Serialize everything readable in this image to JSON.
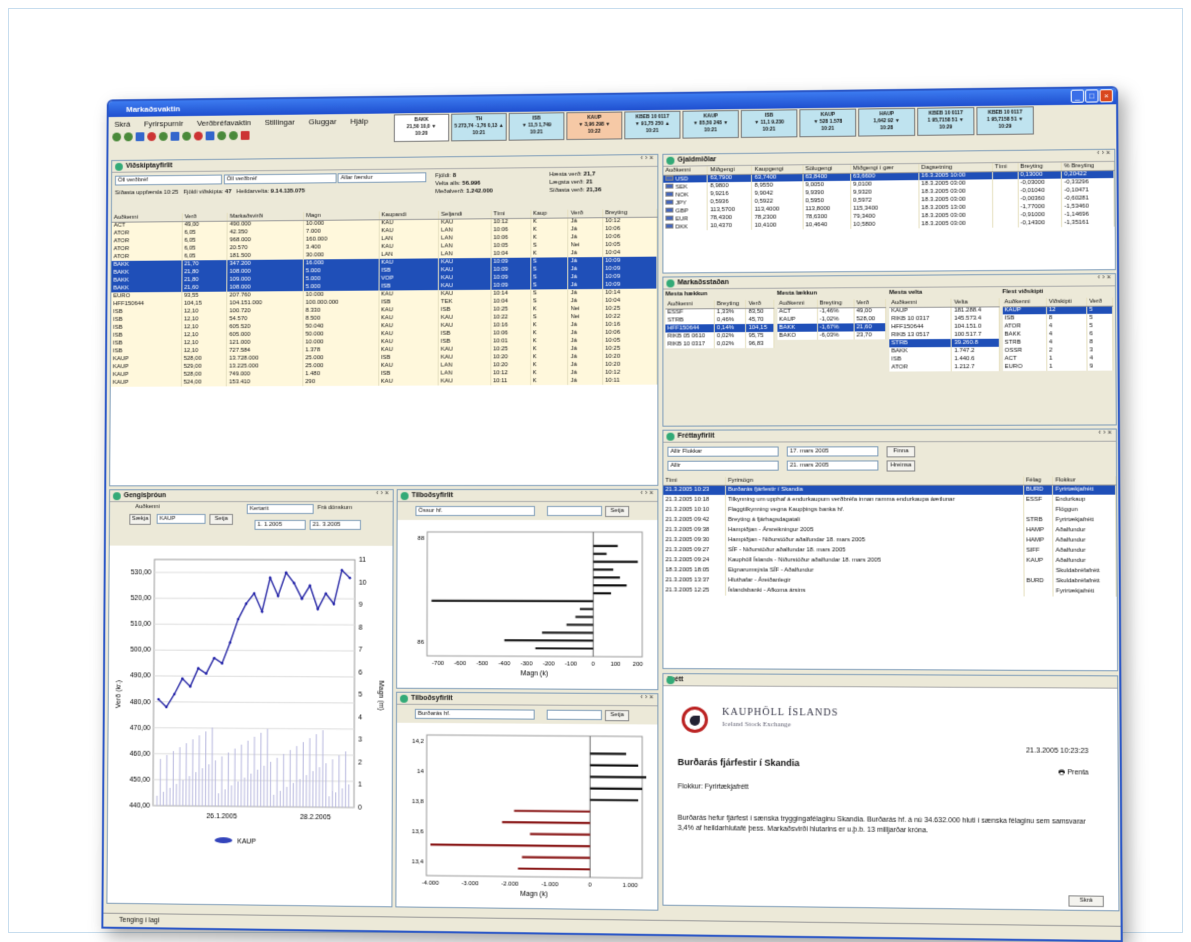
{
  "window": {
    "title": "Markaðsvaktin"
  },
  "menu": [
    "Skrá",
    "Fyrirspurnir",
    "Verðbréfavaktin",
    "Stillingar",
    "Gluggar",
    "Hjálp"
  ],
  "tickers": [
    {
      "l1": "BAKK",
      "l2": "21,50 10,0 ▼",
      "l3": "10:20",
      "color": "#fff",
      "up": false
    },
    {
      "l1": "TH",
      "l2": "5 273,74 -1,76 0,13 ▲",
      "l3": "10:21",
      "color": "#bfe3ef",
      "up": true
    },
    {
      "l1": "ISB",
      "l2": "▼ 11,5 1,749",
      "l3": "10:21",
      "color": "#bfe3ef",
      "up": true
    },
    {
      "l1": "KAUP",
      "l2": "▼ 3,96 298 ▼",
      "l3": "10:22",
      "color": "#f6c9a6",
      "up": false
    },
    {
      "l1": "KBEB 10 0117",
      "l2": "▼ 91,75 250 ▲",
      "l3": "10:21",
      "color": "#bfe3ef",
      "up": true
    },
    {
      "l1": "KAUP",
      "l2": "▼ 85,50 248 ▼",
      "l3": "10:21",
      "color": "#bfe3ef",
      "up": true
    },
    {
      "l1": "ISB",
      "l2": "▼ 11,1 9.230",
      "l3": "10:21",
      "color": "#bfe3ef",
      "up": true
    },
    {
      "l1": "KAUP",
      "l2": "▼ 528 1.578",
      "l3": "10:21",
      "color": "#bfe3ef",
      "up": false
    },
    {
      "l1": "HAUP",
      "l2": "1,642 92 ▼",
      "l3": "10:28",
      "color": "#bfe3ef",
      "up": false
    },
    {
      "l1": "KBEB 10 0117",
      "l2": "1 95,7158 51 ▼",
      "l3": "10:29",
      "color": "#bfe3ef",
      "up": true
    },
    {
      "l1": "KBEB 10 0117",
      "l2": "1 95,7158 51 ▼",
      "l3": "10:29",
      "color": "#bfe3ef",
      "up": true
    }
  ],
  "securities": {
    "title": "Viðskiptayfirlit",
    "filter1": "Öll verðbréf",
    "filter2": "Öll verðbréf",
    "filter3": "Allar færslur",
    "updated": "Síðasta uppfærsla 10:25",
    "total_label": "Fjöldi viðskipta:",
    "total": "47",
    "turnover_label": "Heildarvelta:",
    "turnover": "9.14.135.075",
    "stats": [
      [
        "Fjöldi:",
        "8"
      ],
      [
        "Velta alls:",
        "56.996"
      ],
      [
        "Meðalverð:",
        "1.242.000"
      ]
    ],
    "stats2": [
      [
        "Hæsta verð:",
        "21,7"
      ],
      [
        "Lægsta verð:",
        "21"
      ],
      [
        "Síðasta verð:",
        "21,36"
      ]
    ],
    "columns": [
      "Auðkenni",
      "Verð",
      "Markaðsvirði",
      "Magn",
      "Kaupandi",
      "Seljandi",
      "Tími",
      "Kaup",
      "Verð",
      "Breyting"
    ],
    "rows": [
      [
        "ACT",
        "49,00",
        "490.000",
        "10.000",
        "KAU",
        "KAU",
        "10:12",
        "K",
        "Já",
        "10:12"
      ],
      [
        "ATOR",
        "6,05",
        "42.350",
        "7.000",
        "KAU",
        "LAN",
        "10:06",
        "K",
        "Já",
        "10:06"
      ],
      [
        "ATOR",
        "6,05",
        "968.000",
        "160.000",
        "LAN",
        "LAN",
        "10:06",
        "K",
        "Já",
        "10:06"
      ],
      [
        "ATOR",
        "6,05",
        "20.570",
        "3.400",
        "KAU",
        "LAN",
        "10:05",
        "S",
        "Nei",
        "10:05"
      ],
      [
        "ATOR",
        "6,05",
        "181.500",
        "30.000",
        "LAN",
        "LAN",
        "10:04",
        "K",
        "Já",
        "10:04"
      ],
      [
        "BAKK",
        "21,70",
        "347.200",
        "16.000",
        "KAU",
        "KAU",
        "10:09",
        "S",
        "Já",
        "10:09"
      ],
      [
        "BAKK",
        "21,80",
        "108.000",
        "5.000",
        "ISB",
        "KAU",
        "10:09",
        "S",
        "Já",
        "10:09"
      ],
      [
        "BAKK",
        "21,80",
        "109.000",
        "5.000",
        "VOP",
        "KAU",
        "10:09",
        "S",
        "Já",
        "10:09"
      ],
      [
        "BAKK",
        "21,60",
        "108.000",
        "5.000",
        "ISB",
        "KAU",
        "10:09",
        "S",
        "Já",
        "10:09"
      ],
      [
        "EURO",
        "93,55",
        "207.760",
        "10.000",
        "KAU",
        "KAU",
        "10:14",
        "S",
        "Já",
        "10:14"
      ],
      [
        "HFF150644",
        "104,15",
        "104.151.000",
        "100.000.000",
        "ISB",
        "TEK",
        "10:04",
        "S",
        "Já",
        "10:04"
      ],
      [
        "ISB",
        "12,10",
        "100.720",
        "8.330",
        "KAU",
        "ISB",
        "10:25",
        "K",
        "Nei",
        "10:25"
      ],
      [
        "ISB",
        "12,10",
        "54.570",
        "8.500",
        "KAU",
        "KAU",
        "10:22",
        "S",
        "Nei",
        "10:22"
      ],
      [
        "ISB",
        "12,10",
        "605.520",
        "50.040",
        "KAU",
        "KAU",
        "10:16",
        "K",
        "Já",
        "10:16"
      ],
      [
        "ISB",
        "12,10",
        "605.000",
        "50.000",
        "KAU",
        "ISB",
        "10:06",
        "K",
        "Já",
        "10:06"
      ],
      [
        "ISB",
        "12,10",
        "121.000",
        "10.000",
        "KAU",
        "ISB",
        "10:01",
        "K",
        "Já",
        "10:05"
      ],
      [
        "ISB",
        "12,10",
        "727.584",
        "1.378",
        "KAU",
        "KAU",
        "10:25",
        "K",
        "Já",
        "10:25"
      ],
      [
        "KAUP",
        "528,00",
        "13.728.000",
        "25.000",
        "ISB",
        "KAU",
        "10:20",
        "K",
        "Já",
        "10:20"
      ],
      [
        "KAUP",
        "529,00",
        "13.225.000",
        "25.000",
        "KAU",
        "LAN",
        "10:20",
        "K",
        "Já",
        "10:20"
      ],
      [
        "KAUP",
        "528,00",
        "749.000",
        "1.480",
        "ISB",
        "LAN",
        "10:12",
        "K",
        "Já",
        "10:12"
      ],
      [
        "KAUP",
        "524,00",
        "153.410",
        "290",
        "KAU",
        "KAU",
        "10:11",
        "K",
        "Já",
        "10:11"
      ]
    ]
  },
  "currency": {
    "title": "Gjaldmiðlar",
    "columns": [
      "Auðkenni",
      "Miðgengi",
      "Kaupgengi",
      "Sölugengi",
      "Miðgengi í gær",
      "Dagsetning",
      "Tími",
      "Breyting",
      "% Breyting"
    ],
    "rows": [
      [
        "USD",
        "63,7900",
        "63,7400",
        "63,8400",
        "63,6600",
        "16.3.2005 10:00",
        "",
        "0,13000",
        "0,20422"
      ],
      [
        "SEK",
        "8,9800",
        "8,9550",
        "9,0050",
        "9,0100",
        "18.3.2005 03:00",
        "",
        "-0,03000",
        "-0,33296"
      ],
      [
        "NOK",
        "9,9216",
        "9,9042",
        "9,9390",
        "9,9320",
        "18.3.2005 03:00",
        "",
        "-0,01040",
        "-0,10471"
      ],
      [
        "JPY",
        "0,5936",
        "0,5922",
        "0,5950",
        "0,5972",
        "18.3.2005 03:00",
        "",
        "-0,00360",
        "-0,60281"
      ],
      [
        "GBP",
        "113,5700",
        "113,4000",
        "113,8000",
        "115,3400",
        "18.3.2005 13:00",
        "",
        "-1,77000",
        "-1,53460"
      ],
      [
        "EUR",
        "78,4300",
        "78,2300",
        "78,6300",
        "79,3400",
        "18.3.2005 03:00",
        "",
        "-0,91000",
        "-1,14696"
      ],
      [
        "DKK",
        "10,4370",
        "10,4100",
        "10,4640",
        "10,5800",
        "18.3.2005 03:00",
        "",
        "-0,14300",
        "-1,35161"
      ]
    ]
  },
  "market": {
    "title": "Markaðsstaðan",
    "sections": [
      {
        "heading": "Mesta hækkun",
        "cols": [
          "Auðkenni",
          "Breyting",
          "Verð"
        ],
        "rows": [
          [
            "ESSF",
            "1,33%",
            "83,50"
          ],
          [
            "STRB",
            "0,46%",
            "45,70"
          ],
          [
            "HFF150644",
            "0,14%",
            "104,15"
          ],
          [
            "RIKB 05 0610",
            "0,02%",
            "95,75"
          ],
          [
            "RIKB 10 0317",
            "0,02%",
            "96,83"
          ]
        ]
      },
      {
        "heading": "Mesta lækkun",
        "cols": [
          "Auðkenni",
          "Breyting",
          "Verð"
        ],
        "rows": [
          [
            "ACT",
            "-1,46%",
            "49,00"
          ],
          [
            "KAUP",
            "-1,02%",
            "528,00"
          ],
          [
            "BAKK",
            "-1,67%",
            "21,60"
          ],
          [
            "BAKO",
            "-6,03%",
            "23,70"
          ]
        ]
      },
      {
        "heading": "Mesta velta",
        "cols": [
          "Auðkenni",
          "Velta"
        ],
        "rows": [
          [
            "KAUP",
            "181.288.4"
          ],
          [
            "RIKB 10 0317",
            "145.573.4"
          ],
          [
            "HFF150644",
            "104.151.0"
          ],
          [
            "RIKB 13 0517",
            "100.517.7"
          ],
          [
            "STRB",
            "39.260.8"
          ],
          [
            "BAKK",
            "1.747.2"
          ],
          [
            "ISB",
            "1.440.6"
          ],
          [
            "ATOR",
            "1.212.7"
          ]
        ]
      },
      {
        "heading": "Flest viðskipti",
        "cols": [
          "Auðkenni",
          "Viðskipti",
          "Verð"
        ],
        "rows": [
          [
            "KAUP",
            "12",
            "5"
          ],
          [
            "ISB",
            "8",
            "5"
          ],
          [
            "ATOR",
            "4",
            "5"
          ],
          [
            "BAKK",
            "4",
            "6"
          ],
          [
            "STRB",
            "4",
            "8"
          ],
          [
            "OSSR",
            "2",
            "3"
          ],
          [
            "ACT",
            "1",
            "4"
          ],
          [
            "EURO",
            "1",
            "9"
          ]
        ]
      }
    ]
  },
  "news": {
    "title": "Fréttayfirlit",
    "filter1": "Allir Flokkar",
    "filter2": "Allir",
    "date1": "17.   mars   2005",
    "date2": "21.   mars   2005",
    "btn1": "Finna",
    "btn2": "Hreinsa",
    "columns": [
      "Tími",
      "Fyrirsögn",
      "Félag",
      "Flokkur"
    ],
    "rows": [
      [
        "21.3.2005 10:23",
        "Burðarás fjárfestir í Skandia",
        "BURD",
        "Fyrirtækjafrétt"
      ],
      [
        "21.3.2005 10:18",
        "Tilkynning um upphaf á endurkaupum verðbréfa innan ramma endurkaupa áætlunar",
        "ESSF",
        "Endurkaup"
      ],
      [
        "21.3.2005 10:10",
        "Flaggtilkynning vegna Kaupþings banka hf.",
        "",
        "Flöggun"
      ],
      [
        "21.3.2005 09:42",
        "Breyting á fjárhagsdagatali",
        "STRB",
        "Fyrirtækjafrétt"
      ],
      [
        "21.3.2005 09:38",
        "Hampiðjan - Ársreikningur 2005",
        "HAMP",
        "Aðalfundur"
      ],
      [
        "21.3.2005 09:30",
        "Hampiðjan - Niðurstöður aðalfundar 18. mars 2005",
        "HAMP",
        "Aðalfundur"
      ],
      [
        "21.3.2005 09:27",
        "SÍF - Niðurstöður aðalfundar 18. mars 2005",
        "SIFF",
        "Aðalfundur"
      ],
      [
        "21.3.2005 09:24",
        "Kauphöll Íslands - Niðurstöður aðalfundar 18. mars 2005",
        "KAUP",
        "Aðalfundur"
      ],
      [
        "18.3.2005 18:05",
        "Eignarumsýsla SÍF - Aðalfundur",
        "",
        "Skuldabréfafrétt"
      ],
      [
        "21.3.2005 13:37",
        "Hluthafar - Áreiðanlegir",
        "BURD",
        "Skuldabréfafrétt"
      ],
      [
        "21.3.2005 12:25",
        "Íslandsbanki - Afkoma ársins",
        "",
        "Fyrirtækjafrétt"
      ]
    ]
  },
  "detail": {
    "header": "Frétt",
    "exchange": "KAUPHÖLL ÍSLANDS",
    "exchange_en": "Iceland Stock Exchange",
    "datetime": "21.3.2005 10:23:23",
    "headline": "Burðarás fjárfestir í Skandia",
    "print": "Prenta",
    "category": "Flokkur: Fyrirtækjafrétt",
    "body": "Burðarás hefur fjárfest í sænska tryggingafélaginu Skandia.  Burðarás hf. á nú 34.632.000 hluti í sænska félaginu sem samsvarar 3,4% af heildarhlutafé þess.  Markaðsvirði hlutarins er u.þ.b. 13 milljarðar króna.",
    "close": "Skrá"
  },
  "price_chart": {
    "title": "Gengisþróun",
    "symbol_label": "Auðkenni",
    "symbol": "KAUP",
    "btn": "Setja",
    "btn2": "Sækja",
    "type": "Kertarit",
    "period_label": "Frá dönskum",
    "date_from": "1. 1.2005",
    "date_to": "21. 3.2005",
    "legend": "KAUP"
  },
  "bids": {
    "title": "Tilboðsyfirlit",
    "symbol": "Össur hf.",
    "btn": "Setja",
    "xlabel": "Magn (k)"
  },
  "offers": {
    "title": "Tilboðsyfirlit",
    "symbol": "Burðarás hf.",
    "btn": "Setja",
    "xlabel": "Magn (k)"
  },
  "status": "Tenging í lagi",
  "chart_data": [
    {
      "type": "line",
      "title": "",
      "xlabel": "",
      "ylabel": "Verð (kr.)",
      "ylabel2": "Magn (m)",
      "x_ticks": [
        "26.1.2005",
        "28.2.2005"
      ],
      "y_ticks": [
        440,
        450,
        460,
        470,
        480,
        490,
        500,
        510,
        520,
        530
      ],
      "y2_ticks": [
        0,
        1,
        2,
        3,
        4,
        5,
        6,
        7,
        8,
        9,
        10,
        11
      ],
      "ylim": [
        440,
        535
      ],
      "y2lim": [
        0,
        11
      ],
      "series": [
        {
          "name": "KAUP",
          "values": [
            481,
            478,
            483,
            489,
            486,
            493,
            491,
            497,
            495,
            503,
            512,
            518,
            522,
            515,
            528,
            521,
            530,
            526,
            520,
            525,
            516,
            522,
            518,
            531,
            528
          ]
        }
      ]
    },
    {
      "type": "bar",
      "title": "",
      "xlabel": "Magn (k)",
      "ylabel": "",
      "y_ticks": [
        86,
        88
      ],
      "x_ticks": [
        -700,
        -600,
        -500,
        -400,
        -300,
        -200,
        -100,
        0,
        100,
        200
      ],
      "xlim": [
        -750,
        220
      ],
      "series": [
        {
          "name": "",
          "values": [
            -260,
            -400,
            -230,
            -120,
            -80,
            -60,
            -730,
            80,
            150,
            120,
            90,
            200,
            60,
            110
          ]
        }
      ]
    },
    {
      "type": "bar",
      "title": "",
      "xlabel": "Magn (k)",
      "ylabel": "",
      "y_ticks": [
        13.4,
        13.6,
        13.8,
        14,
        14.2
      ],
      "x_ticks": [
        -4000,
        -3000,
        -2000,
        -1000,
        0,
        1000
      ],
      "xlim": [
        -4100,
        1300
      ],
      "series": [
        {
          "name": "",
          "values": [
            -1800,
            -1700,
            -4000,
            -1500,
            -2200,
            -1900,
            1200,
            1300,
            1400,
            1200,
            900
          ]
        }
      ]
    }
  ]
}
